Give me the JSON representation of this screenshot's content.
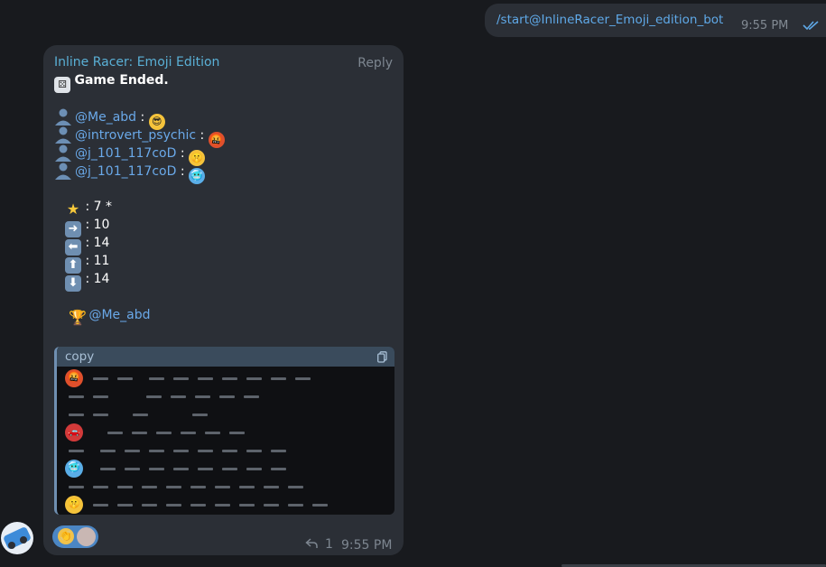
{
  "outgoing": {
    "text": "/start@InlineRacer_Emoji_edition_bot",
    "time": "9:55 PM",
    "icon": "double-check-icon"
  },
  "incoming": {
    "sender": "Inline Racer: Emoji Edition",
    "reply_label": "Reply",
    "status": "Game Ended.",
    "players": [
      {
        "name": "@Me_abd",
        "sep": " : ",
        "emoji": "sunglasses-face"
      },
      {
        "name": "@introvert_psychic",
        "sep": " : ",
        "emoji": "cursing-face"
      },
      {
        "name": "@j_101_117coD",
        "sep": " : ",
        "emoji": "shushing-face"
      },
      {
        "name": "@j_101_117coD",
        "sep": " : ",
        "emoji": "cold-face"
      }
    ],
    "stats": [
      {
        "icon": "star-icon",
        "text": ": 7 *"
      },
      {
        "icon": "arrow-right-icon",
        "text": ": 10"
      },
      {
        "icon": "arrow-left-icon",
        "text": ": 14"
      },
      {
        "icon": "arrow-up-icon",
        "text": ": 11"
      },
      {
        "icon": "arrow-down-icon",
        "text": ": 14"
      }
    ],
    "winner": "@Me_abd",
    "code_label": "copy",
    "reply_count": "1",
    "time": "9:55 PM"
  },
  "colors": {
    "background": "#181a1e",
    "bubble": "#2b2f36",
    "mention": "#6aa9e9",
    "sender": "#5ab0d6",
    "reaction": "#4b86c4"
  }
}
